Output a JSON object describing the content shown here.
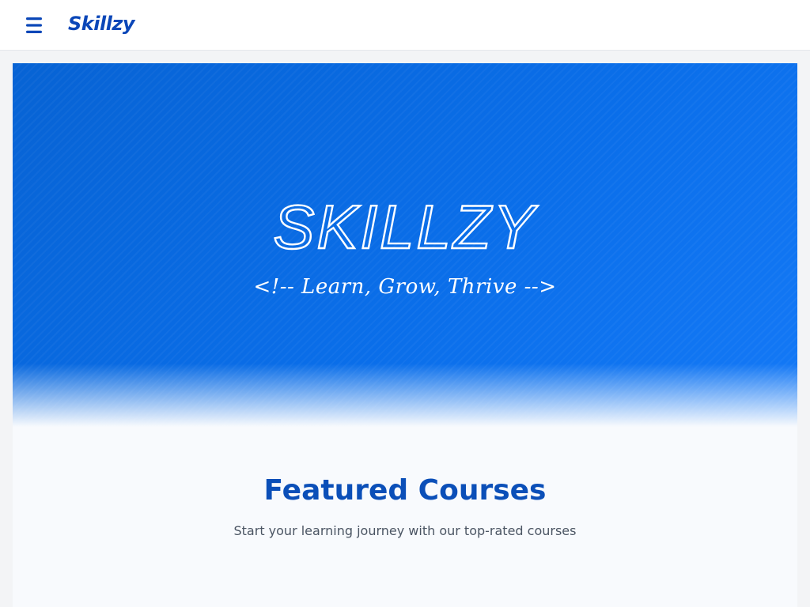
{
  "header": {
    "brand": "Skillzy",
    "menu_icon": "hamburger-menu-icon"
  },
  "hero": {
    "title": "SKILLZY",
    "tagline": "<!-- Learn, Grow, Thrive -->"
  },
  "featured": {
    "title": "Featured Courses",
    "subtitle": "Start your learning journey with our top-rated courses"
  },
  "colors": {
    "brand": "#0b47b8",
    "hero_start": "#0763d4",
    "hero_end": "#1479f7",
    "heading": "#0b4fb8",
    "subtext": "#4b5563"
  }
}
